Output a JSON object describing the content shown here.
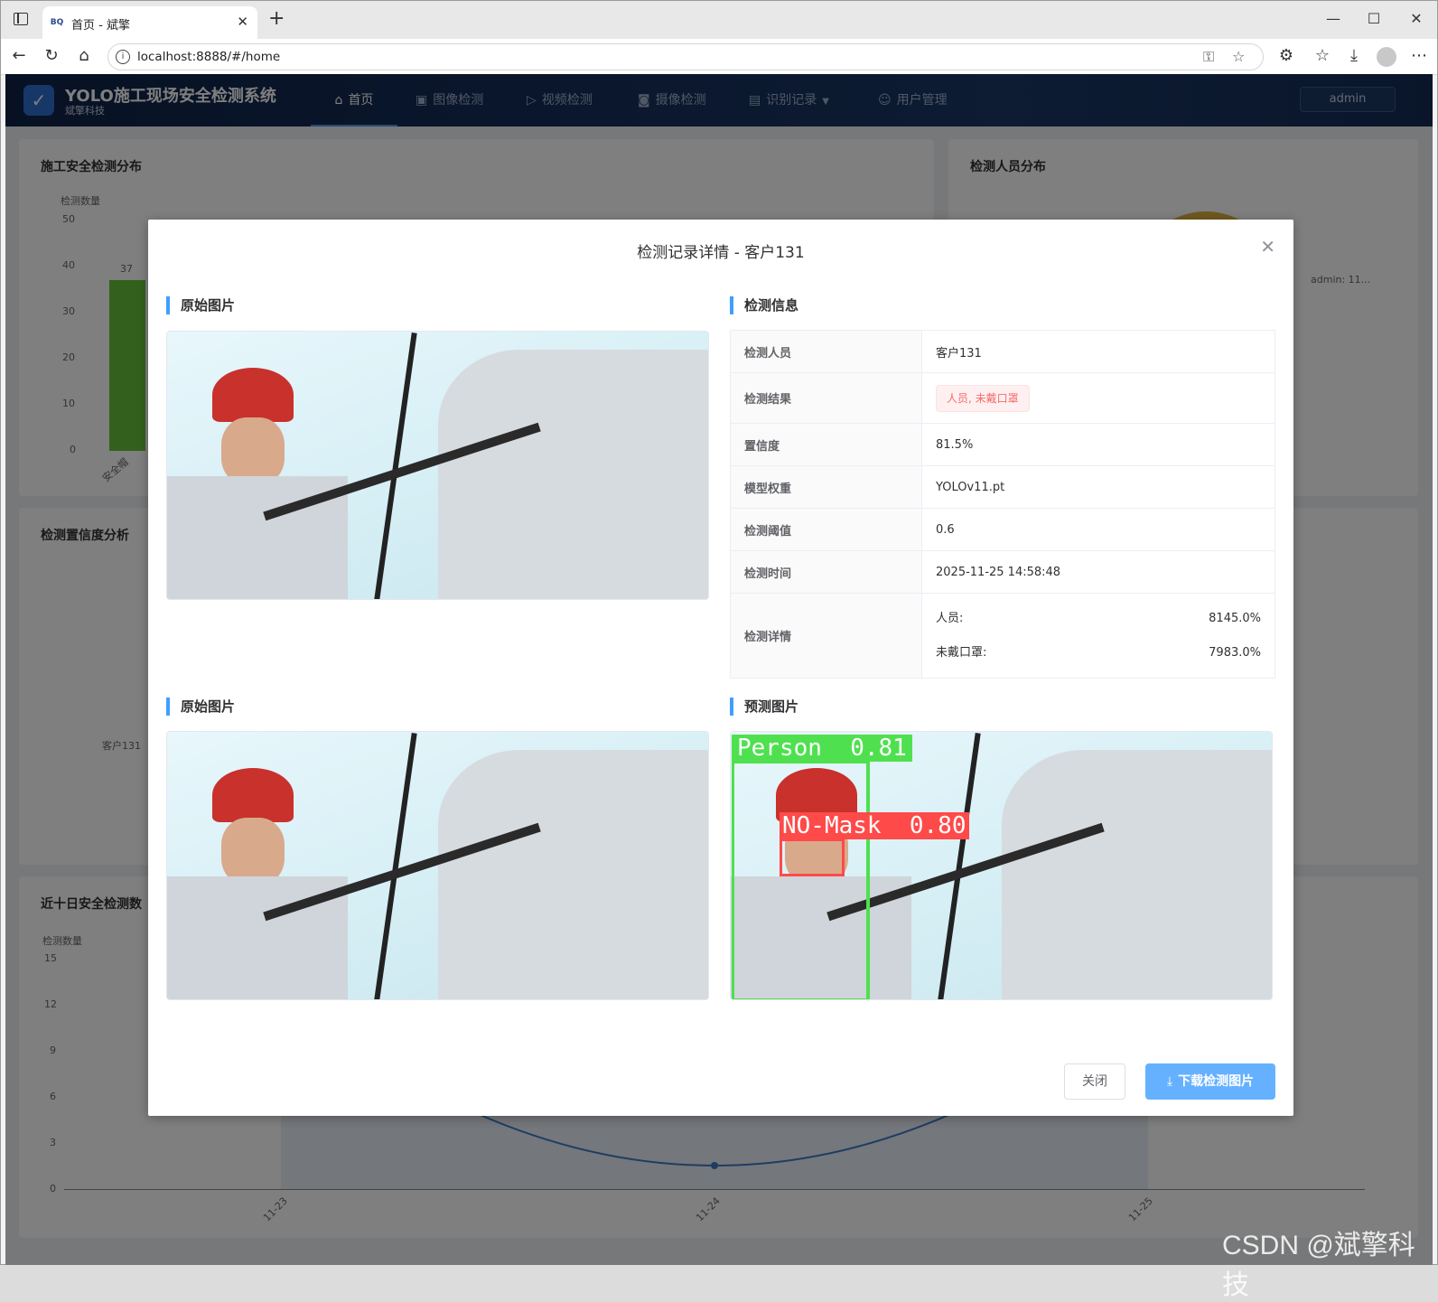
{
  "browser": {
    "tab_title": "首页 - 斌擎",
    "favicon_text": "BQ",
    "url": "localhost:8888/#/home"
  },
  "app": {
    "title": "YOLO施工现场安全检测系统",
    "subtitle": "斌擎科技",
    "menu": [
      {
        "label": "首页",
        "icon": "home-icon",
        "active": true
      },
      {
        "label": "图像检测",
        "icon": "image-icon"
      },
      {
        "label": "视频检测",
        "icon": "video-icon"
      },
      {
        "label": "摄像检测",
        "icon": "camera-icon"
      },
      {
        "label": "识别记录",
        "icon": "document-icon"
      },
      {
        "label": "用户管理",
        "icon": "user-icon"
      }
    ],
    "user": "admin"
  },
  "background": {
    "card1": {
      "title": "施工安全检测分布",
      "ylabel": "检测数量",
      "yticks": [
        "50",
        "40",
        "30",
        "20",
        "10",
        "0"
      ],
      "bar_label": "37",
      "bar_category": "安全帽"
    },
    "card2": {
      "title": "检测人员分布",
      "legend": "admin: 11..."
    },
    "card3": {
      "title": "检测置信度分析",
      "label": "客户131"
    },
    "card4": {
      "title": "近十日安全检测数",
      "ylabel": "检测数量",
      "yticks": [
        "15",
        "12",
        "9",
        "6",
        "3",
        "0"
      ],
      "xticks": [
        "11-23",
        "11-24",
        "11-25"
      ]
    }
  },
  "chart_data": [
    {
      "type": "bar",
      "title": "施工安全检测分布",
      "ylabel": "检测数量",
      "categories": [
        "安全帽"
      ],
      "values": [
        37
      ],
      "ylim": [
        0,
        50
      ]
    },
    {
      "type": "line",
      "title": "近十日安全检测数",
      "ylabel": "检测数量",
      "x": [
        "11-23",
        "11-24",
        "11-25"
      ],
      "ylim": [
        0,
        15
      ]
    }
  ],
  "dialog": {
    "title": "检测记录详情 - 客户131",
    "sections": {
      "original_top": "原始图片",
      "info": "检测信息",
      "original_bottom": "原始图片",
      "predicted": "预测图片"
    },
    "info": {
      "person_label": "检测人员",
      "person": "客户131",
      "result_label": "检测结果",
      "result": "人员, 未戴口罩",
      "confidence_label": "置信度",
      "confidence": "81.5%",
      "model_label": "模型权重",
      "model": "YOLOv11.pt",
      "threshold_label": "检测阈值",
      "threshold": "0.6",
      "time_label": "检测时间",
      "time": "2025-11-25 14:58:48",
      "detail_label": "检测详情",
      "details": [
        {
          "name": "人员:",
          "value": "8145.0%"
        },
        {
          "name": "未戴口罩:",
          "value": "7983.0%"
        }
      ]
    },
    "boxes": {
      "person": "Person  0.81",
      "nomask": "NO-Mask  0.80"
    },
    "buttons": {
      "close": "关闭",
      "download": "下载检测图片"
    }
  },
  "watermark": "CSDN @斌擎科技"
}
